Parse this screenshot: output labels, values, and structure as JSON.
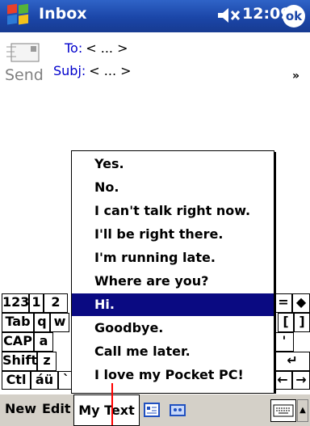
{
  "titlebar": {
    "title": "Inbox",
    "time": "12:09",
    "ok_label": "ok"
  },
  "header": {
    "send_label": "Send",
    "to_label": "To:",
    "to_value": "< ... >",
    "subj_label": "Subj:",
    "subj_value": "< ... >"
  },
  "popup": {
    "items": [
      {
        "label": "Yes."
      },
      {
        "label": "No."
      },
      {
        "label": "I can't talk right now."
      },
      {
        "label": "I'll be right there."
      },
      {
        "label": "I'm running late."
      },
      {
        "label": "Where are you?"
      },
      {
        "label": "Hi."
      },
      {
        "label": "Goodbye."
      },
      {
        "label": "Call me later."
      },
      {
        "label": "I love my Pocket PC!"
      }
    ],
    "selected_item": "Hi."
  },
  "keyboard": {
    "keys": {
      "k123": "123",
      "k1": "1",
      "k2": "2",
      "tab": "Tab",
      "q": "q",
      "w": "w",
      "cap": "CAP",
      "a": "a",
      "shift": "Shift",
      "z": "z",
      "ctl": "Ctl",
      "intl": "áü",
      "tick": "`",
      "eq": "=",
      "lbr": "[",
      "rbr": "]",
      "quote": "'",
      "left": "←",
      "right": "→",
      "enter": "↵",
      "back": "◆"
    }
  },
  "menubar": {
    "new_label": "New",
    "edit_label": "Edit",
    "mytext_label": "My Text"
  }
}
